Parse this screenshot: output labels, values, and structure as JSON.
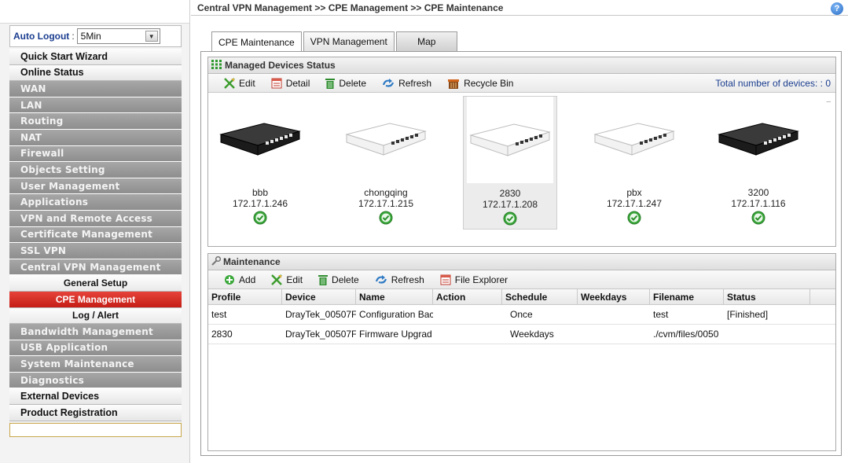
{
  "sidebar": {
    "logout_label": "Auto Logout",
    "logout_sep": ":",
    "logout_value": "5Min",
    "menu": [
      {
        "label": "Quick Start Wizard",
        "style": "white"
      },
      {
        "label": "Online Status",
        "style": "white"
      },
      {
        "label": "WAN",
        "style": "grey"
      },
      {
        "label": "LAN",
        "style": "grey"
      },
      {
        "label": "Routing",
        "style": "grey"
      },
      {
        "label": "NAT",
        "style": "grey"
      },
      {
        "label": "Firewall",
        "style": "grey"
      },
      {
        "label": "Objects Setting",
        "style": "grey"
      },
      {
        "label": "User Management",
        "style": "grey"
      },
      {
        "label": "Applications",
        "style": "grey"
      },
      {
        "label": "VPN and Remote Access",
        "style": "grey"
      },
      {
        "label": "Certificate Management",
        "style": "grey"
      },
      {
        "label": "SSL VPN",
        "style": "grey"
      },
      {
        "label": "Central VPN Management",
        "style": "grey"
      },
      {
        "label": "General Setup",
        "style": "sub"
      },
      {
        "label": "CPE Management",
        "style": "sub active"
      },
      {
        "label": "Log / Alert",
        "style": "sub"
      },
      {
        "label": "Bandwidth Management",
        "style": "grey"
      },
      {
        "label": "USB Application",
        "style": "grey"
      },
      {
        "label": "System Maintenance",
        "style": "grey"
      },
      {
        "label": "Diagnostics",
        "style": "grey"
      },
      {
        "label": "External Devices",
        "style": "white"
      },
      {
        "label": "Product Registration",
        "style": "white"
      }
    ]
  },
  "header": {
    "breadcrumb": "Central VPN Management >> CPE Management >> CPE Maintenance",
    "help_icon": "?"
  },
  "tabs": [
    {
      "label": "CPE Maintenance",
      "active": true
    },
    {
      "label": "VPN Management",
      "active": false
    },
    {
      "label": "Map",
      "active": false
    }
  ],
  "managed": {
    "title": "Managed Devices Status",
    "toolbar": {
      "edit": "Edit",
      "detail": "Detail",
      "delete": "Delete",
      "refresh": "Refresh",
      "recycle": "Recycle Bin"
    },
    "total_label": "Total number of devices: : 0",
    "devices": [
      {
        "name": "bbb",
        "ip": "172.17.1.246",
        "color": "black"
      },
      {
        "name": "chongqing",
        "ip": "172.17.1.215",
        "color": "white"
      },
      {
        "name": "2830",
        "ip": "172.17.1.208",
        "color": "white"
      },
      {
        "name": "pbx",
        "ip": "172.17.1.247",
        "color": "white"
      },
      {
        "name": "3200",
        "ip": "172.17.1.116",
        "color": "black"
      }
    ]
  },
  "maintenance": {
    "title": "Maintenance",
    "toolbar": {
      "add": "Add",
      "edit": "Edit",
      "delete": "Delete",
      "refresh": "Refresh",
      "file_explorer": "File Explorer"
    },
    "columns": [
      "Profile",
      "Device",
      "Name",
      "Action",
      "Schedule",
      "Weekdays",
      "Filename",
      "Status"
    ],
    "rows": [
      [
        "test",
        "DrayTek_00507F_",
        "Configuration Bac",
        "",
        "Once",
        "",
        "test",
        "[Finished]"
      ],
      [
        "2830",
        "DrayTek_00507F_",
        "Firmware Upgrad",
        "",
        "Weekdays",
        "",
        "./cvm/files/0050",
        ""
      ]
    ]
  },
  "colors": {
    "accent_red": "#c41e16",
    "menu_grey": "#9a9a9a",
    "title_blue": "#1a3d8f",
    "ok_green": "#3aa83a"
  }
}
